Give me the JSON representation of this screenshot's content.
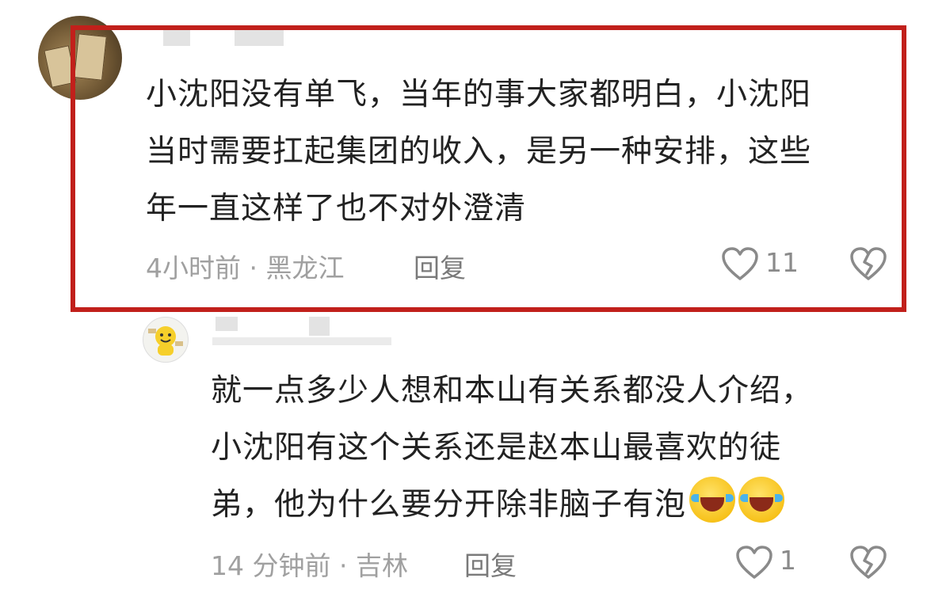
{
  "comments": [
    {
      "text_lines": [
        "小沈阳没有单飞，当年的事大家都明白，小沈阳",
        "当时需要扛起集团的收入，是另一种安排，这些",
        "年一直这样了也不对外澄清"
      ],
      "time": "4小时前",
      "location": "黑龙江",
      "reply_label": "回复",
      "like_count": "11"
    },
    {
      "text_lines": [
        "就一点多少人想和本山有关系都没人介绍，",
        "小沈阳有这个关系还是赵本山最喜欢的徒",
        "弟，他为什么要分开除非脑子有泡"
      ],
      "emojis": [
        "laughing-crying-emoji",
        "laughing-crying-emoji"
      ],
      "time": "14 分钟前",
      "location": "吉林",
      "reply_label": "回复",
      "like_count": "1"
    }
  ],
  "separator": "·",
  "icons": {
    "like": "heart-outline-icon",
    "dislike": "broken-heart-icon"
  },
  "colors": {
    "highlight_border": "#c1201b",
    "meta_text": "#a0a0a0"
  }
}
